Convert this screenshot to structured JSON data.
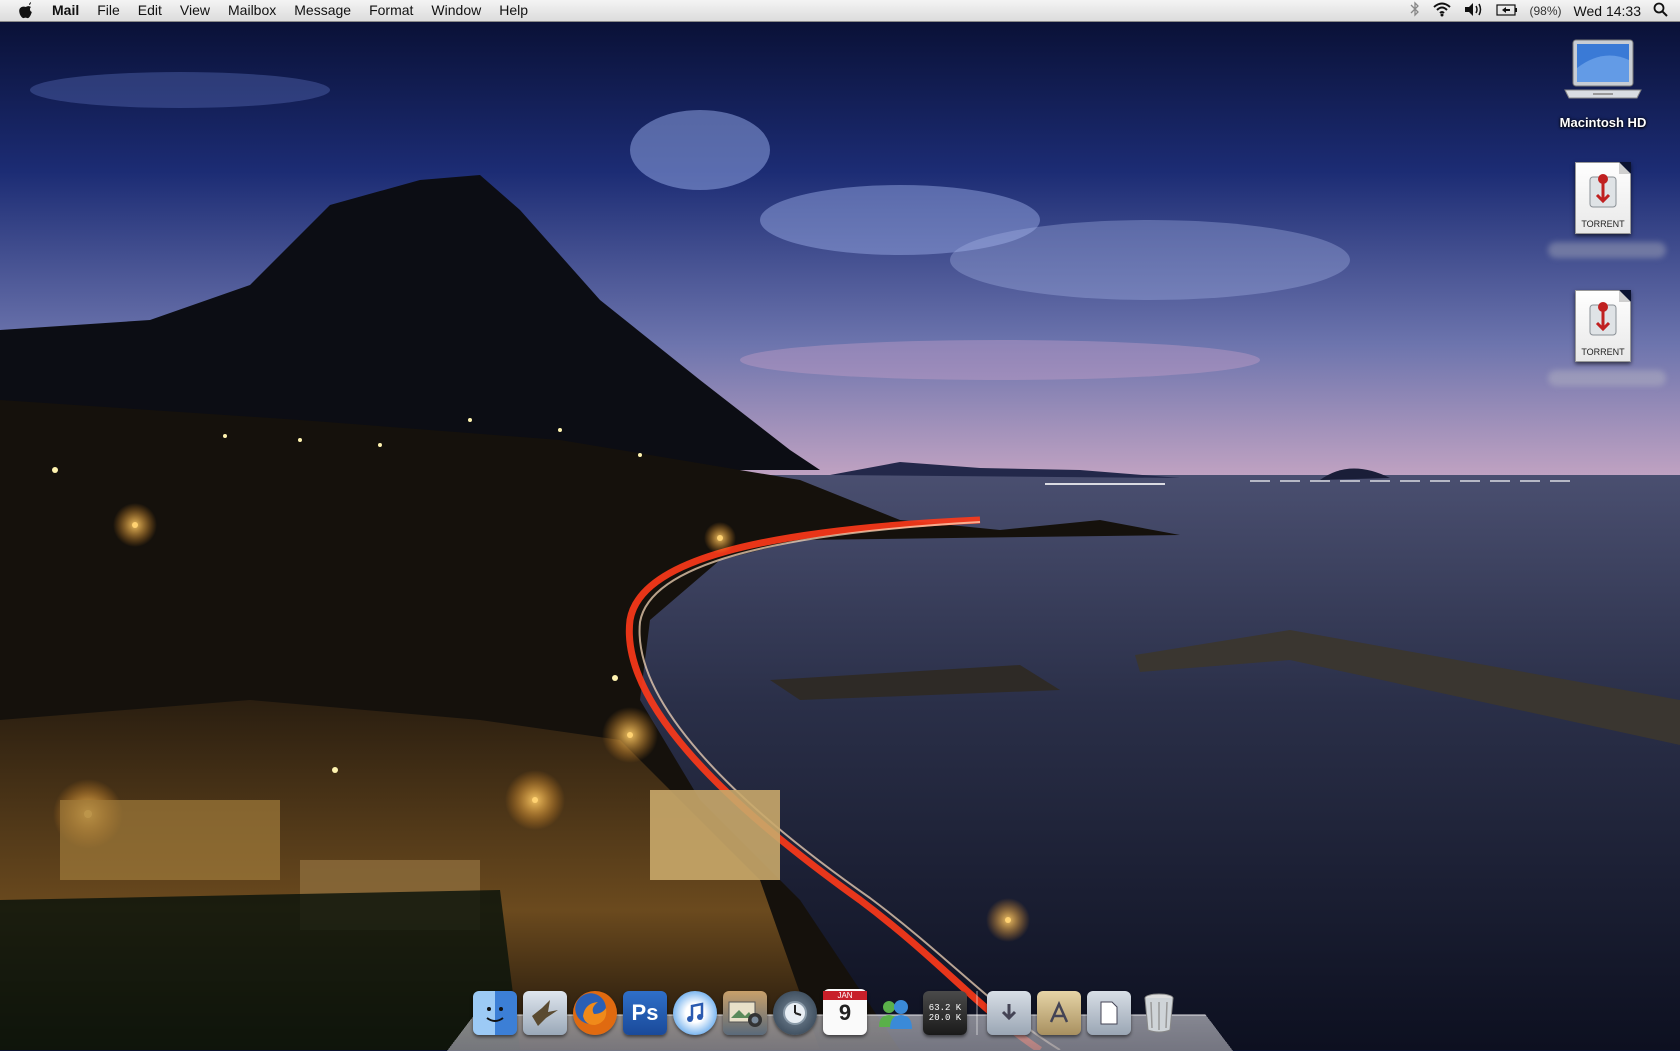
{
  "menubar": {
    "app_name": "Mail",
    "menus": [
      "File",
      "Edit",
      "View",
      "Mailbox",
      "Message",
      "Format",
      "Window",
      "Help"
    ],
    "battery_percent": "(98%)",
    "clock": "Wed 14:33",
    "status_icons": [
      "bluetooth-icon",
      "wifi-icon",
      "volume-icon",
      "battery-icon",
      "spotlight-search-icon"
    ]
  },
  "desktop": {
    "icons": [
      {
        "label": "Macintosh HD",
        "type": "hard-drive"
      },
      {
        "label": "TORRENT",
        "type": "torrent-file"
      },
      {
        "label": "TORRENT",
        "type": "torrent-file"
      }
    ]
  },
  "dock": {
    "apps": [
      "finder-icon",
      "mail-icon",
      "firefox-icon",
      "photoshop-icon",
      "itunes-icon",
      "iphoto-icon",
      "time-machine-icon",
      "ical-icon",
      "messenger-icon",
      "network-meter-icon"
    ],
    "ical_month": "JAN",
    "ical_day": "9",
    "photoshop_label": "Ps",
    "net_up": "63.2 K",
    "net_down": "20.0 K",
    "stacks": [
      "downloads-stack-icon",
      "applications-stack-icon",
      "documents-stack-icon",
      "trash-icon"
    ]
  },
  "colors": {
    "menubar_bg": "#e6e6e6",
    "sky_top": "#0a1340",
    "sky_horizon": "#c9a7c4",
    "sea": "#2a2f48",
    "light_trail": "#ff3a1a"
  }
}
